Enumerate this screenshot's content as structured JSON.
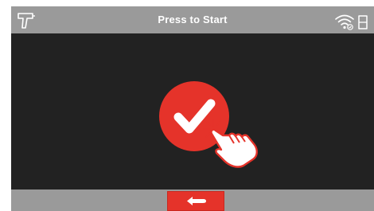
{
  "header": {
    "title": "Press to Start",
    "left_icon": "scanner-icon",
    "right_icons": [
      "wifi-icon",
      "sd-card-icon"
    ]
  },
  "main": {
    "start_button_icon": "checkmark-icon",
    "pointer_icon": "hand-tap-icon"
  },
  "footer": {
    "back_button_icon": "return-arrow-icon"
  },
  "colors": {
    "accent": "#e5332a",
    "bar": "#9a9a9a",
    "background": "#222222",
    "text": "#ffffff"
  }
}
